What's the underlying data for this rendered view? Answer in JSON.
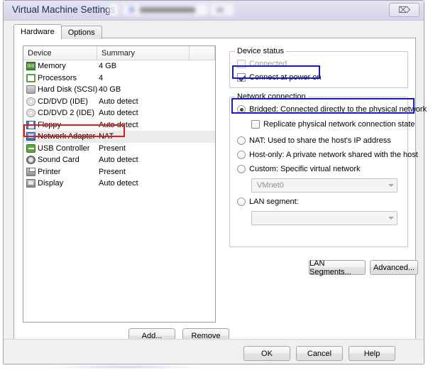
{
  "window": {
    "title": "Virtual Machine Settings",
    "close_label": "⌦",
    "close_icon": "close-icon",
    "redacted_tab": ""
  },
  "tabs": [
    {
      "label": "Hardware",
      "active": true
    },
    {
      "label": "Options",
      "active": false
    }
  ],
  "device_list": {
    "columns": [
      "Device",
      "Summary"
    ],
    "rows": [
      {
        "icon": "memory-icon",
        "name": "Memory",
        "summary": "4 GB",
        "selected": false
      },
      {
        "icon": "processor-icon",
        "name": "Processors",
        "summary": "4",
        "selected": false
      },
      {
        "icon": "hard-disk-icon",
        "name": "Hard Disk (SCSI)",
        "summary": "40 GB",
        "selected": false
      },
      {
        "icon": "cd-dvd-icon",
        "name": "CD/DVD (IDE)",
        "summary": "Auto detect",
        "selected": false
      },
      {
        "icon": "cd-dvd-icon",
        "name": "CD/DVD 2 (IDE)",
        "summary": "Auto detect",
        "selected": false
      },
      {
        "icon": "floppy-icon",
        "name": "Floppy",
        "summary": "Auto detect",
        "selected": false
      },
      {
        "icon": "network-adapter-icon",
        "name": "Network Adapter",
        "summary": "NAT",
        "selected": true
      },
      {
        "icon": "usb-controller-icon",
        "name": "USB Controller",
        "summary": "Present",
        "selected": false
      },
      {
        "icon": "sound-card-icon",
        "name": "Sound Card",
        "summary": "Auto detect",
        "selected": false
      },
      {
        "icon": "printer-icon",
        "name": "Printer",
        "summary": "Present",
        "selected": false
      },
      {
        "icon": "display-icon",
        "name": "Display",
        "summary": "Auto detect",
        "selected": false
      }
    ],
    "add_label": "Add...",
    "remove_label": "Remove"
  },
  "device_status": {
    "title": "Device status",
    "connected": {
      "label": "Connected",
      "checked": false,
      "disabled": true
    },
    "connect_at_power_on": {
      "label": "Connect at power on",
      "checked": true,
      "disabled": false
    }
  },
  "network_connection": {
    "title": "Network connection",
    "options": [
      {
        "label": "Bridged: Connected directly to the physical network",
        "selected": true
      },
      {
        "label": "NAT: Used to share the host's IP address",
        "selected": false
      },
      {
        "label": "Host-only: A private network shared with the host",
        "selected": false
      },
      {
        "label": "Custom: Specific virtual network",
        "selected": false
      },
      {
        "label": "LAN segment:",
        "selected": false
      }
    ],
    "replicate": {
      "label": "Replicate physical network connection state",
      "checked": false
    },
    "custom_network_value": "VMnet0",
    "lan_segment_value": "",
    "lan_segments_label": "LAN Segments...",
    "advanced_label": "Advanced..."
  },
  "footer": {
    "ok_label": "OK",
    "cancel_label": "Cancel",
    "help_label": "Help"
  },
  "annotations": {
    "device_row_highlight_color": "#e01b1b",
    "power_on_highlight_color": "#1a1ac4",
    "bridged_highlight_color": "#1a1ac4"
  }
}
